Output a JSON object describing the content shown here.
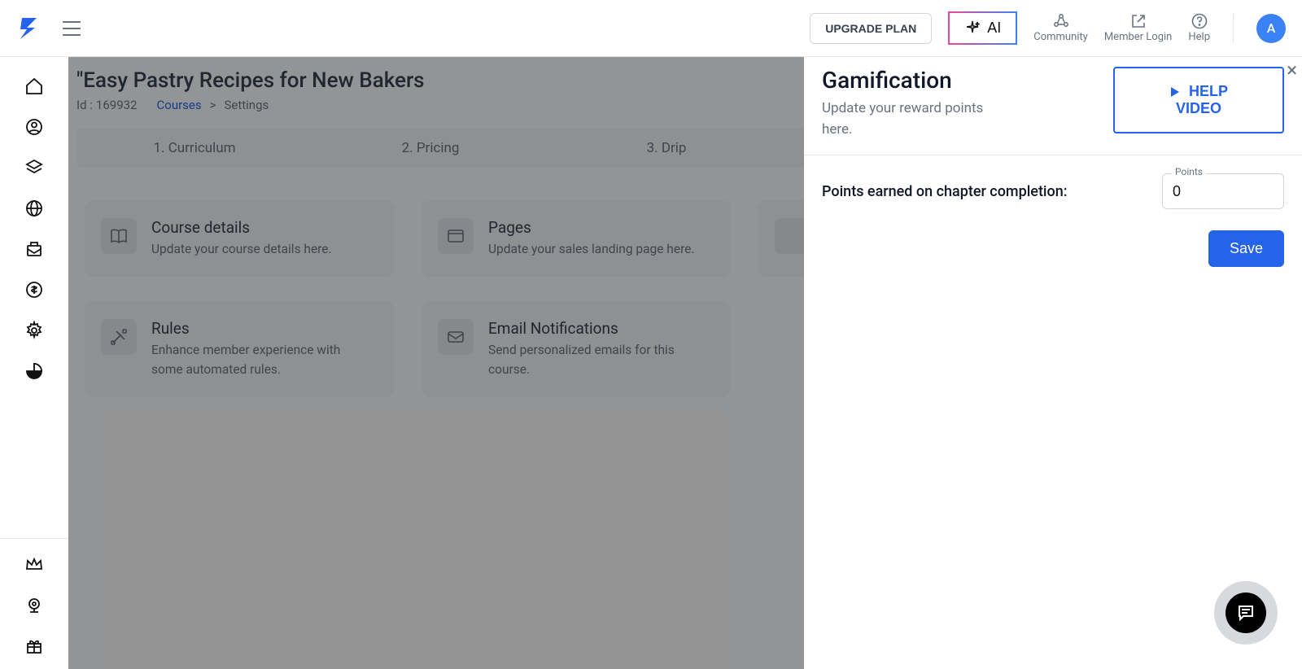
{
  "header": {
    "upgrade_label": "UPGRADE PLAN",
    "ai_label": "AI",
    "community_label": "Community",
    "member_login_label": "Member Login",
    "help_label": "Help",
    "avatar_letter": "A"
  },
  "page": {
    "title": "\"Easy Pastry Recipes for New Bakers",
    "id_prefix": "Id :",
    "id_value": "169932",
    "breadcrumb_courses": "Courses",
    "breadcrumb_sep": ">",
    "breadcrumb_settings": "Settings"
  },
  "tabs": {
    "t1": "1. Curriculum",
    "t2": "2. Pricing",
    "t3": "3. Drip"
  },
  "cards": {
    "c0": {
      "title": "Course details",
      "desc": "Update your course details here."
    },
    "c1": {
      "title": "Pages",
      "desc": "Update your sales landing page here."
    },
    "c2": {
      "title": "",
      "desc": ""
    },
    "c3": {
      "title": "Rules",
      "desc": "Enhance member experience with some automated rules."
    },
    "c4": {
      "title": "Email Notifications",
      "desc": "Send personalized emails for this course."
    }
  },
  "drawer": {
    "title": "Gamification",
    "subtitle": "Update your reward points here.",
    "help_line1": "HELP",
    "help_line2": "VIDEO",
    "points_label": "Points earned on chapter completion:",
    "points_legend": "Points",
    "points_value": "0",
    "save_label": "Save"
  }
}
